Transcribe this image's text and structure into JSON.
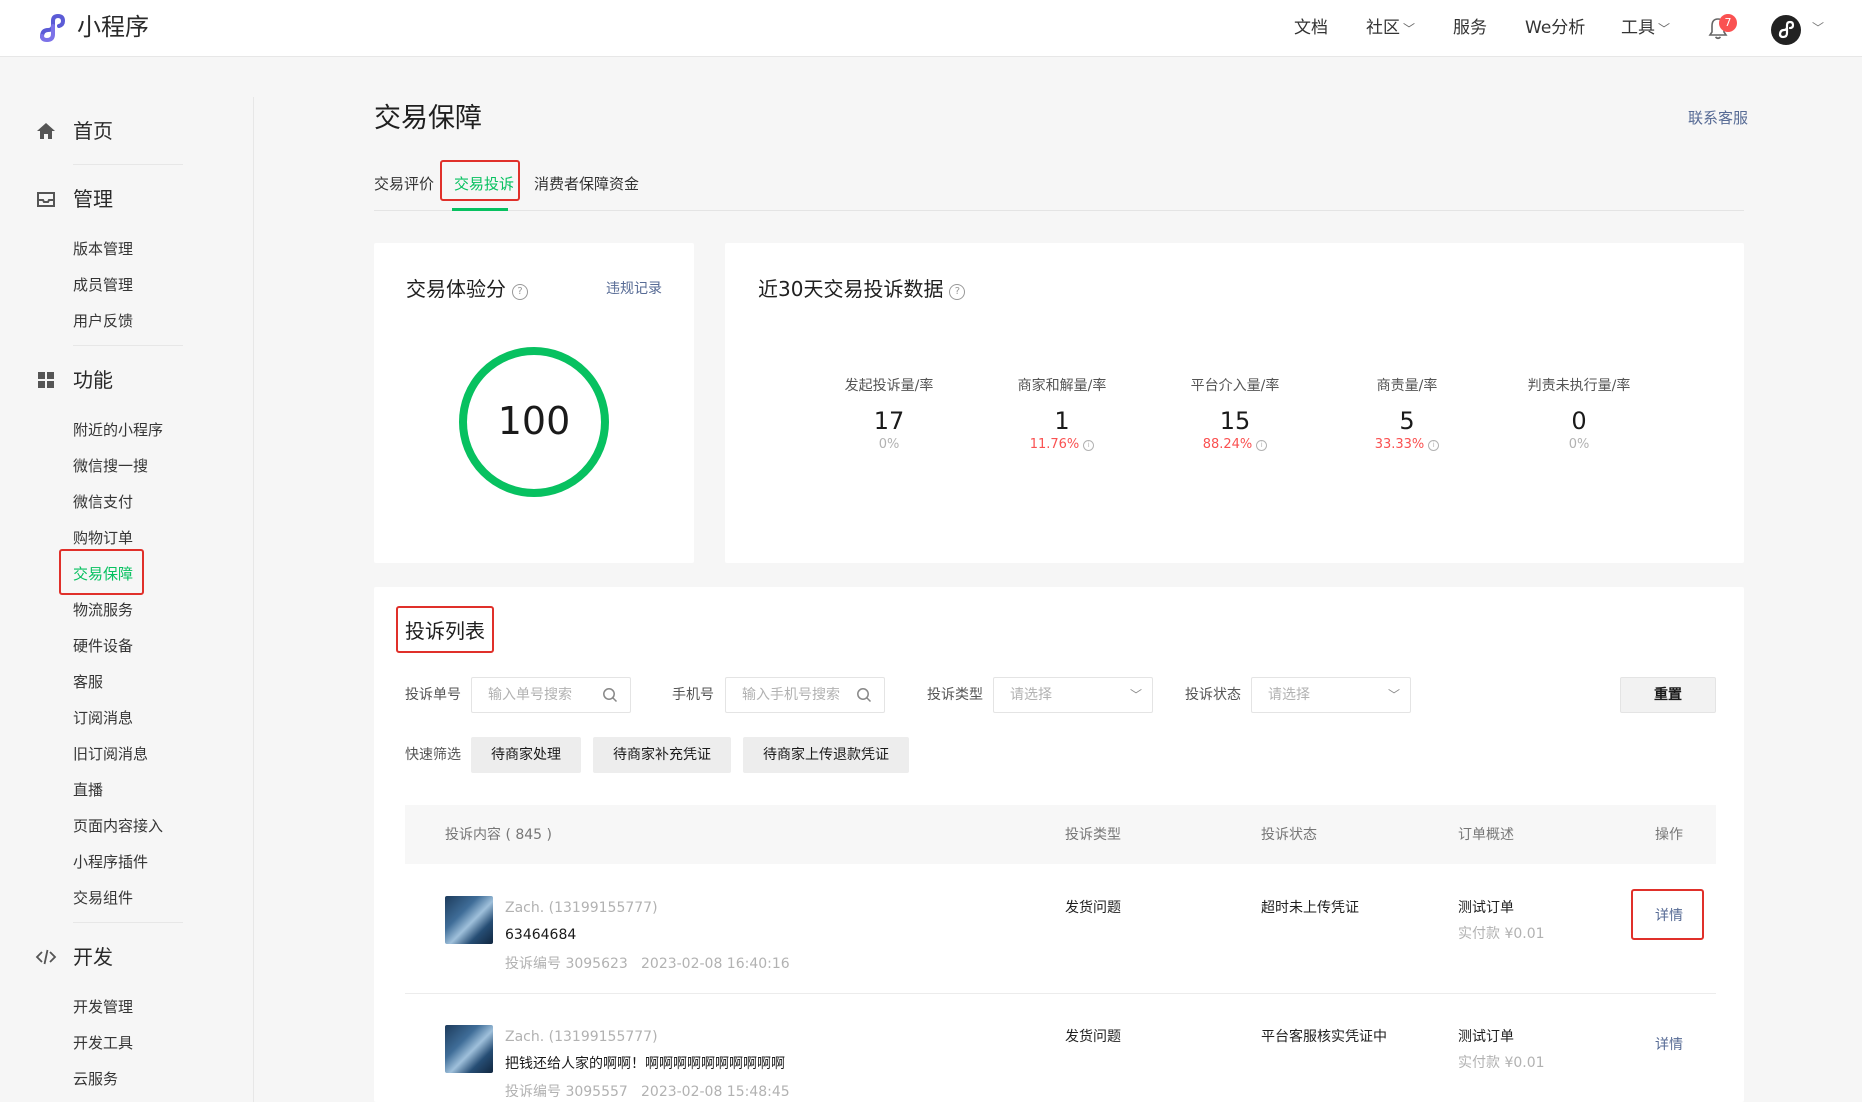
{
  "topbar": {
    "app_title": "小程序",
    "nav": [
      {
        "label": "文档",
        "has_dropdown": false
      },
      {
        "label": "社区",
        "has_dropdown": true
      },
      {
        "label": "服务",
        "has_dropdown": false
      },
      {
        "label": "We分析",
        "has_dropdown": false
      },
      {
        "label": "工具",
        "has_dropdown": true
      }
    ],
    "notification_count": "7",
    "icons": [
      "miniprogram-logo-icon",
      "bell-icon",
      "avatar",
      "chevron-down-icon"
    ]
  },
  "sidebar": {
    "sections": [
      {
        "icon": "home-icon",
        "label": "首页",
        "items": []
      },
      {
        "icon": "inbox-icon",
        "label": "管理",
        "items": [
          "版本管理",
          "成员管理",
          "用户反馈"
        ]
      },
      {
        "icon": "grid-icon",
        "label": "功能",
        "items": [
          "附近的小程序",
          "微信搜一搜",
          "微信支付",
          "购物订单",
          "交易保障",
          "物流服务",
          "硬件设备",
          "客服",
          "订阅消息",
          "旧订阅消息",
          "直播",
          "页面内容接入",
          "小程序插件",
          "交易组件"
        ]
      },
      {
        "icon": "code-icon",
        "label": "开发",
        "items": [
          "开发管理",
          "开发工具",
          "云服务"
        ]
      }
    ],
    "active_item": "交易保障"
  },
  "page": {
    "title": "交易保障",
    "contact_link": "联系客服",
    "tabs": [
      {
        "label": "交易评价",
        "active": false
      },
      {
        "label": "交易投诉",
        "active": true
      },
      {
        "label": "消费者保障资金",
        "active": false
      }
    ]
  },
  "score_card": {
    "title": "交易体验分",
    "violation_link": "违规记录",
    "score": "100",
    "score_fraction": 1.0,
    "ring_color": "#07c160"
  },
  "stats_card": {
    "title": "近30天交易投诉数据",
    "stats": [
      {
        "label": "发起投诉量/率",
        "value": "17",
        "rate": "0%",
        "rate_red": false,
        "info": false
      },
      {
        "label": "商家和解量/率",
        "value": "1",
        "rate": "11.76%",
        "rate_red": true,
        "info": true
      },
      {
        "label": "平台介入量/率",
        "value": "15",
        "rate": "88.24%",
        "rate_red": true,
        "info": true
      },
      {
        "label": "商责量/率",
        "value": "5",
        "rate": "33.33%",
        "rate_red": true,
        "info": true
      },
      {
        "label": "判责未执行量/率",
        "value": "0",
        "rate": "0%",
        "rate_red": false,
        "info": false
      }
    ]
  },
  "complaints": {
    "title": "投诉列表",
    "filters": {
      "order_no_label": "投诉单号",
      "order_no_placeholder": "输入单号搜索",
      "phone_label": "手机号",
      "phone_placeholder": "输入手机号搜索",
      "type_label": "投诉类型",
      "type_placeholder": "请选择",
      "status_label": "投诉状态",
      "status_placeholder": "请选择",
      "reset_label": "重置",
      "quick_label": "快速筛选",
      "quick_chips": [
        "待商家处理",
        "待商家补充凭证",
        "待商家上传退款凭证"
      ]
    },
    "columns": {
      "content": "投诉内容 ( 845 )",
      "type": "投诉类型",
      "status": "投诉状态",
      "order": "订单概述",
      "action": "操作"
    },
    "rows": [
      {
        "user": "Zach. (13199155777)",
        "content": "63464684",
        "complaint_no": "投诉编号 3095623",
        "time": "2023-02-08 16:40:16",
        "type": "发货问题",
        "status": "超时未上传凭证",
        "order_title": "测试订单",
        "paid": "实付款 ¥0.01",
        "action": "详情"
      },
      {
        "user": "Zach. (13199155777)",
        "content": "把钱还给人家的啊啊！啊啊啊啊啊啊啊啊啊啊",
        "complaint_no": "投诉编号 3095557",
        "time": "2023-02-08 15:48:45",
        "type": "发货问题",
        "status": "平台客服核实凭证中",
        "order_title": "测试订单",
        "paid": "实付款 ¥0.01",
        "action": "详情"
      }
    ]
  },
  "colors": {
    "accent": "#07c160",
    "link": "#576b95",
    "danger": "#fa5151",
    "highlight": "#e0302a"
  }
}
